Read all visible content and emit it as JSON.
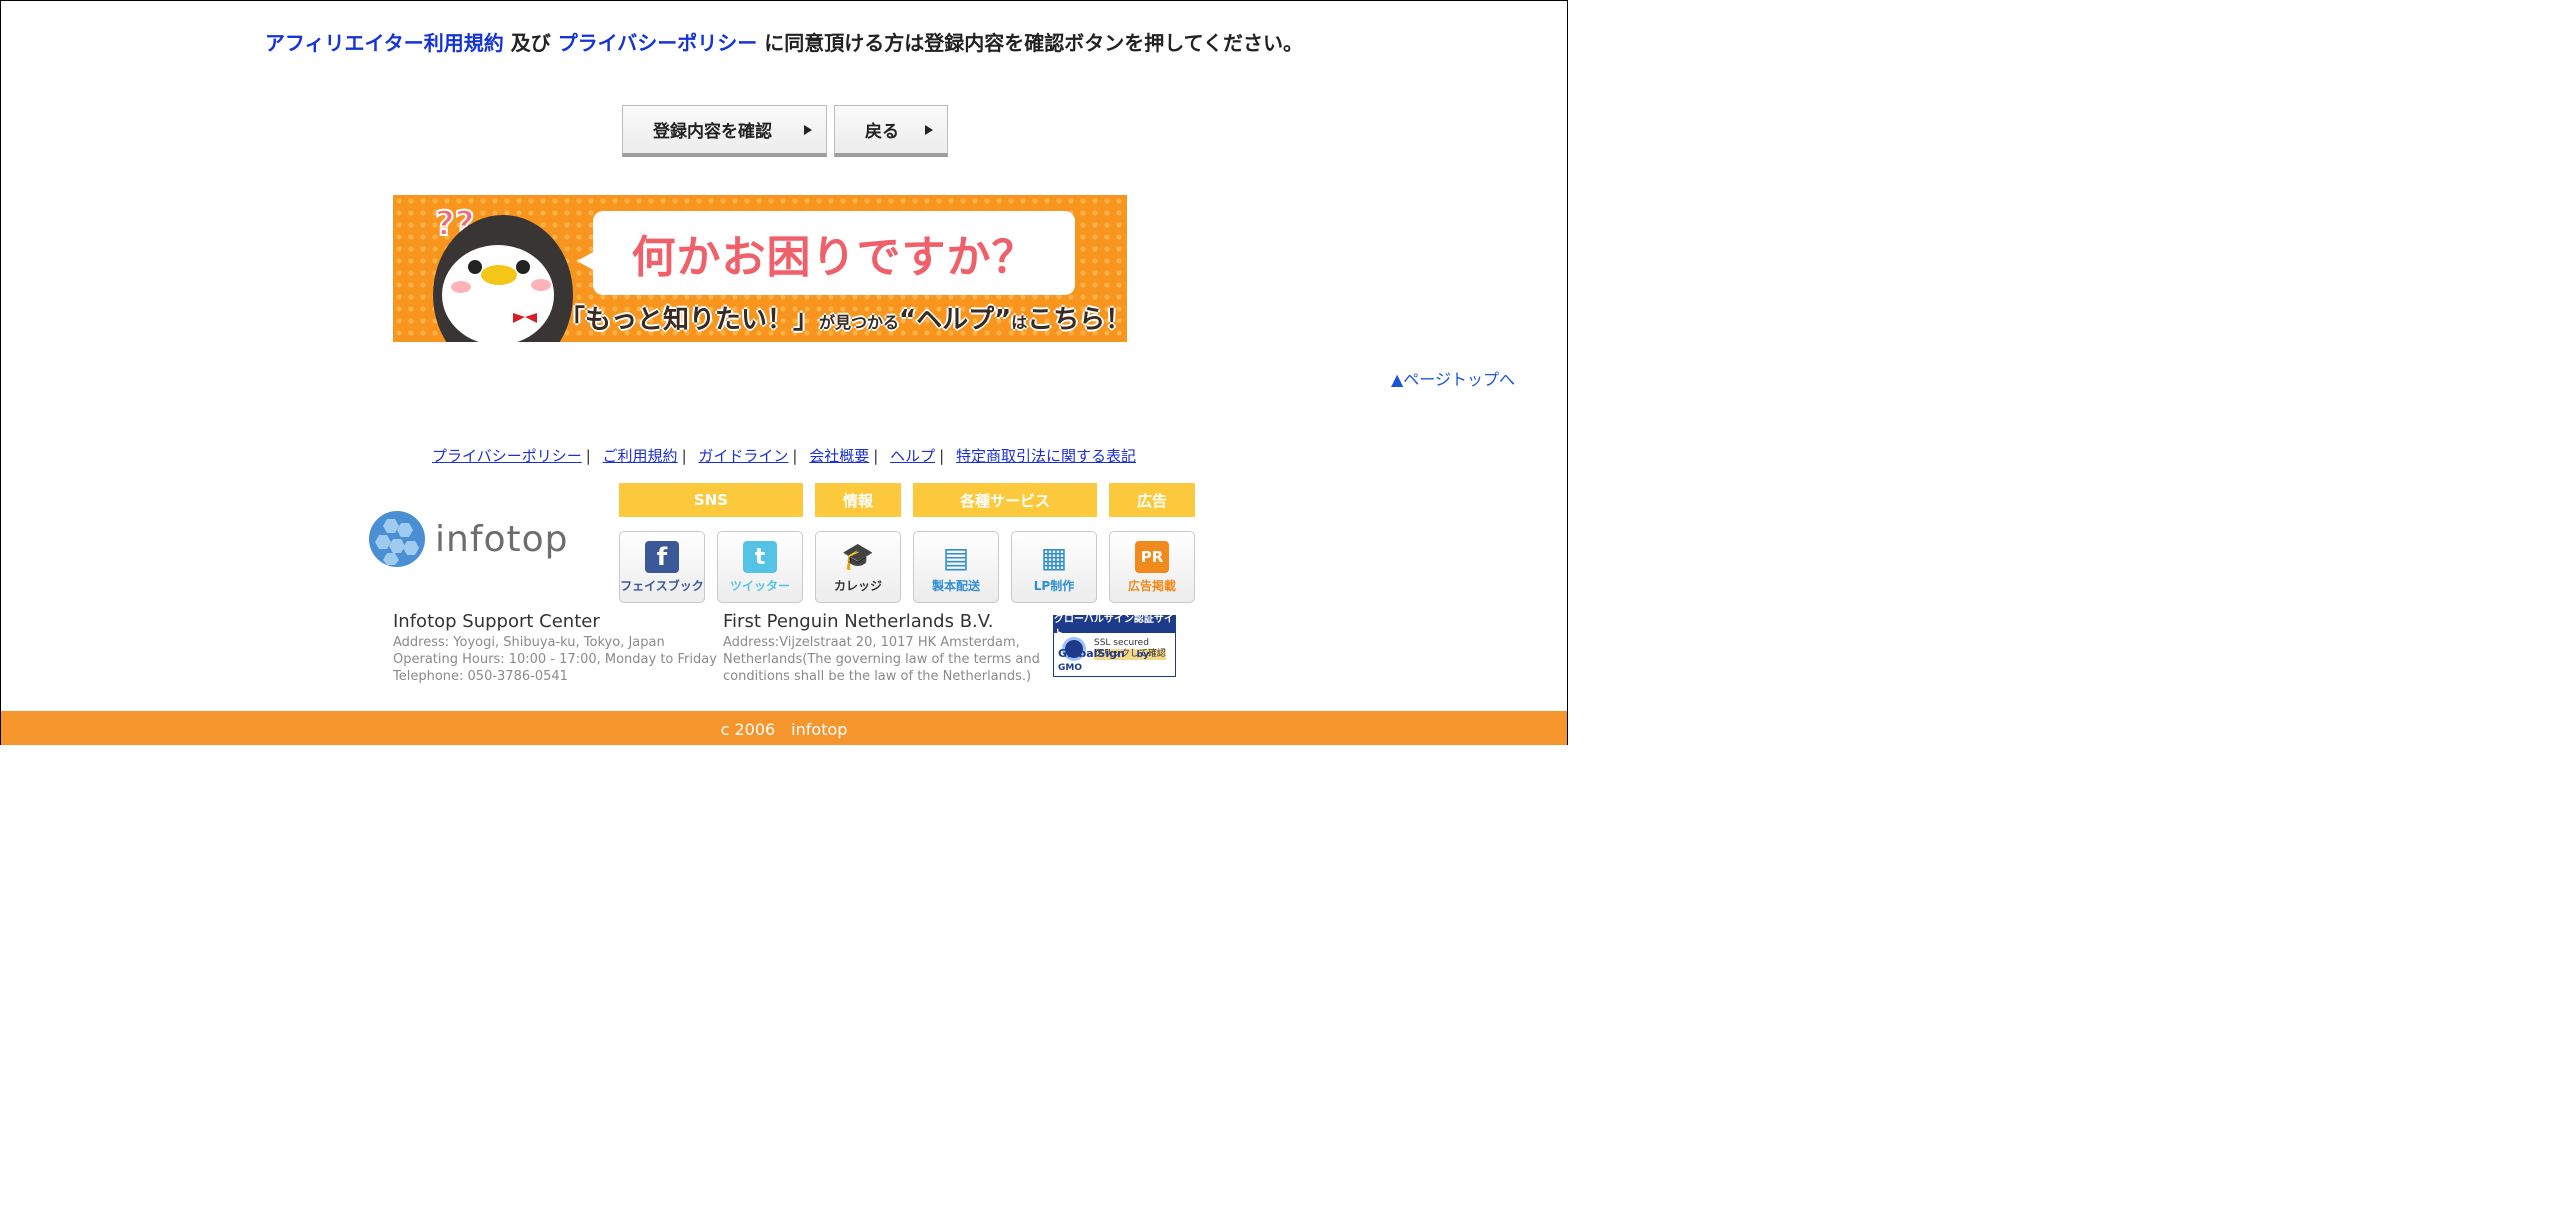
{
  "agreement": {
    "terms_link": "アフィリエイター利用規約",
    "and": " 及び ",
    "privacy_link": "プライバシーポリシー",
    "rest": " に同意頂ける方は登録内容を確認ボタンを押してください。"
  },
  "buttons": {
    "confirm": "登録内容を確認",
    "back": "戻る"
  },
  "banner": {
    "headline": "何かお困りですか？",
    "sub_a": "「もっと知りたい！」",
    "sub_b": "が見つかる",
    "sub_c": "“ヘルプ”",
    "sub_d": "は",
    "sub_e": "こちら！"
  },
  "page_top": "▲ページトップへ",
  "footer_links": [
    "プライバシーポリシー",
    "ご利用規約",
    "ガイドライン",
    "会社概要",
    "ヘルプ",
    "特定商取引法に関する表記"
  ],
  "logo_text": "infotop",
  "categories": [
    "SNS",
    "情報",
    "各種サービス",
    "広告"
  ],
  "tiles": [
    {
      "label": "フェイスブック",
      "icon": "facebook-icon",
      "color": "#3b5998",
      "glyph": "f"
    },
    {
      "label": "ツイッター",
      "icon": "twitter-icon",
      "color": "#55c3e6",
      "glyph": "t"
    },
    {
      "label": "カレッジ",
      "icon": "graduation-cap-icon",
      "color": "#333333",
      "glyph": "🎓"
    },
    {
      "label": "製本配送",
      "icon": "truck-book-icon",
      "color": "#2f8fd0",
      "glyph": "▤"
    },
    {
      "label": "LP制作",
      "icon": "lp-document-icon",
      "color": "#2f8fd0",
      "glyph": "▦"
    },
    {
      "label": "広告掲載",
      "icon": "pr-icon",
      "color": "#f08a1c",
      "glyph": "PR"
    }
  ],
  "support": {
    "title": "Infotop Support Center",
    "address": "Address: Yoyogi, Shibuya-ku, Tokyo, Japan",
    "hours": "Operating Hours: 10:00 - 17:00, Monday to Friday",
    "tel": "Telephone: 050-3786-0541"
  },
  "penguin_co": {
    "title": "First Penguin Netherlands B.V.",
    "address1": "Address:Vijzelstraat 20, 1017 HK Amsterdam,",
    "address2": "Netherlands(The governing law of the terms and",
    "address3": "conditions shall be the law of the Netherlands.)"
  },
  "globalsign": {
    "top": "グローバルサイン認証サイト",
    "ssl1": "SSL secured",
    "ssl2": "クリックして確認",
    "brand": "GlobalSign",
    "by": "by GMO"
  },
  "copyright": "c 2006　infotop",
  "colors": {
    "link": "#1434d8",
    "accent_orange": "#f7952d",
    "category_yellow": "#fcc93c"
  }
}
